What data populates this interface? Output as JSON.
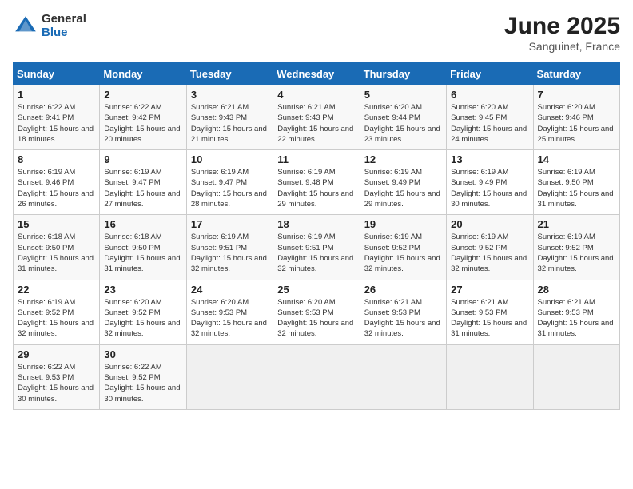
{
  "header": {
    "logo_general": "General",
    "logo_blue": "Blue",
    "month_year": "June 2025",
    "location": "Sanguinet, France"
  },
  "calendar": {
    "days_of_week": [
      "Sunday",
      "Monday",
      "Tuesday",
      "Wednesday",
      "Thursday",
      "Friday",
      "Saturday"
    ],
    "weeks": [
      [
        null,
        {
          "day": 2,
          "sunrise": "6:22 AM",
          "sunset": "9:42 PM",
          "daylight": "15 hours and 20 minutes."
        },
        {
          "day": 3,
          "sunrise": "6:21 AM",
          "sunset": "9:43 PM",
          "daylight": "15 hours and 21 minutes."
        },
        {
          "day": 4,
          "sunrise": "6:21 AM",
          "sunset": "9:43 PM",
          "daylight": "15 hours and 22 minutes."
        },
        {
          "day": 5,
          "sunrise": "6:20 AM",
          "sunset": "9:44 PM",
          "daylight": "15 hours and 23 minutes."
        },
        {
          "day": 6,
          "sunrise": "6:20 AM",
          "sunset": "9:45 PM",
          "daylight": "15 hours and 24 minutes."
        },
        {
          "day": 7,
          "sunrise": "6:20 AM",
          "sunset": "9:46 PM",
          "daylight": "15 hours and 25 minutes."
        }
      ],
      [
        {
          "day": 1,
          "sunrise": "6:22 AM",
          "sunset": "9:41 PM",
          "daylight": "15 hours and 18 minutes."
        },
        null,
        null,
        null,
        null,
        null,
        null
      ],
      [
        {
          "day": 8,
          "sunrise": "6:19 AM",
          "sunset": "9:46 PM",
          "daylight": "15 hours and 26 minutes."
        },
        {
          "day": 9,
          "sunrise": "6:19 AM",
          "sunset": "9:47 PM",
          "daylight": "15 hours and 27 minutes."
        },
        {
          "day": 10,
          "sunrise": "6:19 AM",
          "sunset": "9:47 PM",
          "daylight": "15 hours and 28 minutes."
        },
        {
          "day": 11,
          "sunrise": "6:19 AM",
          "sunset": "9:48 PM",
          "daylight": "15 hours and 29 minutes."
        },
        {
          "day": 12,
          "sunrise": "6:19 AM",
          "sunset": "9:49 PM",
          "daylight": "15 hours and 29 minutes."
        },
        {
          "day": 13,
          "sunrise": "6:19 AM",
          "sunset": "9:49 PM",
          "daylight": "15 hours and 30 minutes."
        },
        {
          "day": 14,
          "sunrise": "6:19 AM",
          "sunset": "9:50 PM",
          "daylight": "15 hours and 31 minutes."
        }
      ],
      [
        {
          "day": 15,
          "sunrise": "6:18 AM",
          "sunset": "9:50 PM",
          "daylight": "15 hours and 31 minutes."
        },
        {
          "day": 16,
          "sunrise": "6:18 AM",
          "sunset": "9:50 PM",
          "daylight": "15 hours and 31 minutes."
        },
        {
          "day": 17,
          "sunrise": "6:19 AM",
          "sunset": "9:51 PM",
          "daylight": "15 hours and 32 minutes."
        },
        {
          "day": 18,
          "sunrise": "6:19 AM",
          "sunset": "9:51 PM",
          "daylight": "15 hours and 32 minutes."
        },
        {
          "day": 19,
          "sunrise": "6:19 AM",
          "sunset": "9:52 PM",
          "daylight": "15 hours and 32 minutes."
        },
        {
          "day": 20,
          "sunrise": "6:19 AM",
          "sunset": "9:52 PM",
          "daylight": "15 hours and 32 minutes."
        },
        {
          "day": 21,
          "sunrise": "6:19 AM",
          "sunset": "9:52 PM",
          "daylight": "15 hours and 32 minutes."
        }
      ],
      [
        {
          "day": 22,
          "sunrise": "6:19 AM",
          "sunset": "9:52 PM",
          "daylight": "15 hours and 32 minutes."
        },
        {
          "day": 23,
          "sunrise": "6:20 AM",
          "sunset": "9:52 PM",
          "daylight": "15 hours and 32 minutes."
        },
        {
          "day": 24,
          "sunrise": "6:20 AM",
          "sunset": "9:53 PM",
          "daylight": "15 hours and 32 minutes."
        },
        {
          "day": 25,
          "sunrise": "6:20 AM",
          "sunset": "9:53 PM",
          "daylight": "15 hours and 32 minutes."
        },
        {
          "day": 26,
          "sunrise": "6:21 AM",
          "sunset": "9:53 PM",
          "daylight": "15 hours and 32 minutes."
        },
        {
          "day": 27,
          "sunrise": "6:21 AM",
          "sunset": "9:53 PM",
          "daylight": "15 hours and 31 minutes."
        },
        {
          "day": 28,
          "sunrise": "6:21 AM",
          "sunset": "9:53 PM",
          "daylight": "15 hours and 31 minutes."
        }
      ],
      [
        {
          "day": 29,
          "sunrise": "6:22 AM",
          "sunset": "9:53 PM",
          "daylight": "15 hours and 30 minutes."
        },
        {
          "day": 30,
          "sunrise": "6:22 AM",
          "sunset": "9:52 PM",
          "daylight": "15 hours and 30 minutes."
        },
        null,
        null,
        null,
        null,
        null
      ]
    ]
  }
}
